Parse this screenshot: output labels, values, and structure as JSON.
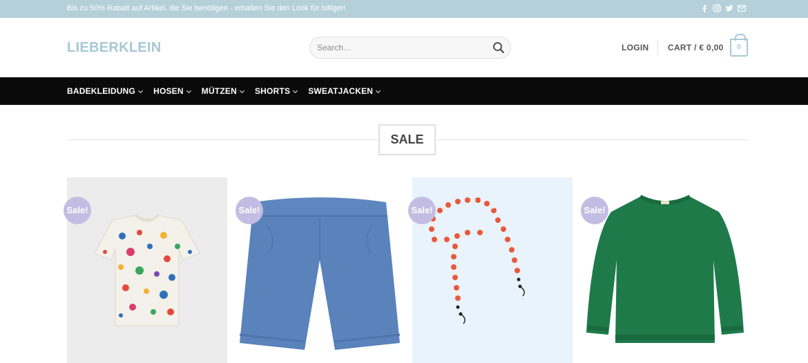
{
  "topbar": {
    "promo_text": "Bis zu 50% Rabatt auf Artikel, die Sie benötigen - erhalten Sie den Look für billiger!",
    "social_icons": [
      "facebook-icon",
      "instagram-icon",
      "twitter-icon",
      "email-icon"
    ]
  },
  "header": {
    "logo": "LIEBERKLEIN",
    "search_placeholder": "Search…",
    "login_label": "LOGIN",
    "cart_label": "CART / € 0,00",
    "cart_count": "0"
  },
  "nav": {
    "items": [
      {
        "label": "BADEKLEIDUNG"
      },
      {
        "label": "HOSEN"
      },
      {
        "label": "MÜTZEN"
      },
      {
        "label": "SHORTS"
      },
      {
        "label": "SWEATJACKEN"
      }
    ]
  },
  "section": {
    "title": "SALE"
  },
  "products": [
    {
      "badge": "Sale!",
      "image": "printed-tshirt"
    },
    {
      "badge": "Sale!",
      "image": "blue-shorts"
    },
    {
      "badge": "Sale!",
      "image": "bead-glasses-chain"
    },
    {
      "badge": "Sale!",
      "image": "green-knit-sweater"
    }
  ],
  "colors": {
    "topbar_bg": "#b5d0d9",
    "accent": "#a7c8d4",
    "nav_bg": "#0a0a0a",
    "badge_bg": "#c3bde3"
  }
}
